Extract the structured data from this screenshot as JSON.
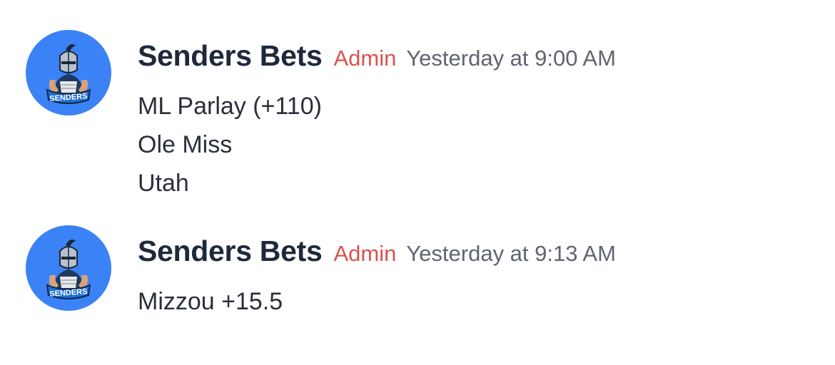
{
  "messages": [
    {
      "author": "Senders Bets",
      "role": "Admin",
      "timestamp": "Yesterday at 9:00 AM",
      "avatar": {
        "icon": "knight-mascot-avatar-icon",
        "text": "SENDERS",
        "background": "#3b82f6"
      },
      "lines": [
        "ML Parlay (+110)",
        "Ole Miss",
        "Utah"
      ]
    },
    {
      "author": "Senders Bets",
      "role": "Admin",
      "timestamp": "Yesterday at 9:13 AM",
      "avatar": {
        "icon": "knight-mascot-avatar-icon",
        "text": "SENDERS",
        "background": "#3b82f6"
      },
      "lines": [
        "Mizzou +15.5"
      ]
    }
  ],
  "colors": {
    "author": "#1e293b",
    "role": "#d9534f",
    "timestamp": "#5f6470",
    "body_text": "#2a2f3a"
  }
}
